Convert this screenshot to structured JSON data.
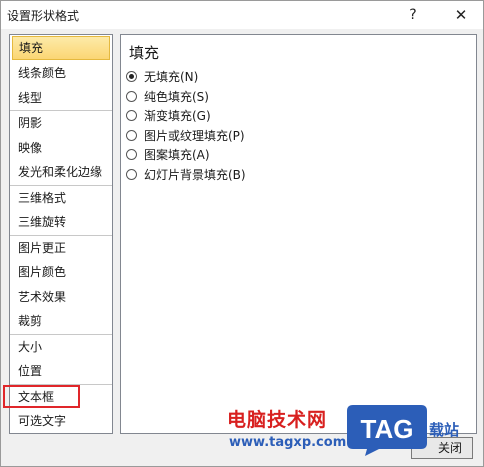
{
  "window": {
    "title": "设置形状格式",
    "help_glyph": "?",
    "close_glyph": "✕"
  },
  "sidebar": {
    "groups": [
      [
        {
          "label": "填充",
          "selected": true
        },
        {
          "label": "线条颜色"
        },
        {
          "label": "线型"
        }
      ],
      [
        {
          "label": "阴影"
        },
        {
          "label": "映像"
        },
        {
          "label": "发光和柔化边缘"
        }
      ],
      [
        {
          "label": "三维格式"
        },
        {
          "label": "三维旋转"
        }
      ],
      [
        {
          "label": "图片更正"
        },
        {
          "label": "图片颜色"
        },
        {
          "label": "艺术效果"
        },
        {
          "label": "裁剪"
        }
      ],
      [
        {
          "label": "大小"
        },
        {
          "label": "位置"
        }
      ],
      [
        {
          "label": "文本框"
        },
        {
          "label": "可选文字"
        }
      ]
    ]
  },
  "fill": {
    "title": "填充",
    "options": [
      {
        "label": "无填充(N)",
        "checked": true
      },
      {
        "label": "纯色填充(S)",
        "checked": false
      },
      {
        "label": "渐变填充(G)",
        "checked": false
      },
      {
        "label": "图片或纹理填充(P)",
        "checked": false
      },
      {
        "label": "图案填充(A)",
        "checked": false
      },
      {
        "label": "幻灯片背景填充(B)",
        "checked": false
      }
    ]
  },
  "footer": {
    "close_label": "关闭"
  },
  "watermark": {
    "site_name": "电脑技术网",
    "url": "www.tagxp.com",
    "logo_text": "TAG",
    "side_text": "载站",
    "colors": {
      "red": "#d8201f",
      "blue": "#2c5eb8"
    }
  },
  "colors": {
    "selected_bg": "#fbd674",
    "highlight_red": "#e0262a",
    "dialog_bg": "#f0f0f0"
  }
}
